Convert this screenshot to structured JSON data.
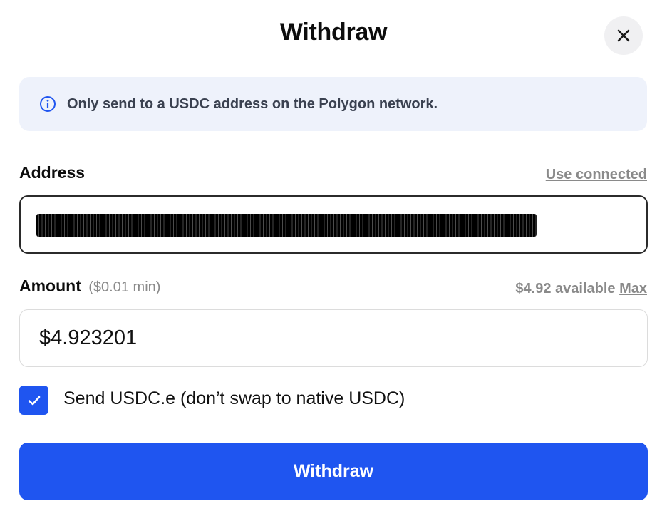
{
  "header": {
    "title": "Withdraw",
    "close_icon": "close-icon"
  },
  "notice": {
    "icon": "info-icon",
    "text": "Only send to a USDC address on the Polygon network.",
    "accent_color": "#1f55f0"
  },
  "address": {
    "label": "Address",
    "use_connected_label": "Use connected",
    "value_redacted": true
  },
  "amount": {
    "label": "Amount",
    "min_note": "($0.01 min)",
    "available_text": "$4.92 available",
    "max_label": "Max",
    "value": "$4.923201"
  },
  "checkbox": {
    "checked": true,
    "label": "Send USDC.e (don’t swap to native USDC)"
  },
  "submit": {
    "label": "Withdraw",
    "color": "#1f55f0"
  }
}
